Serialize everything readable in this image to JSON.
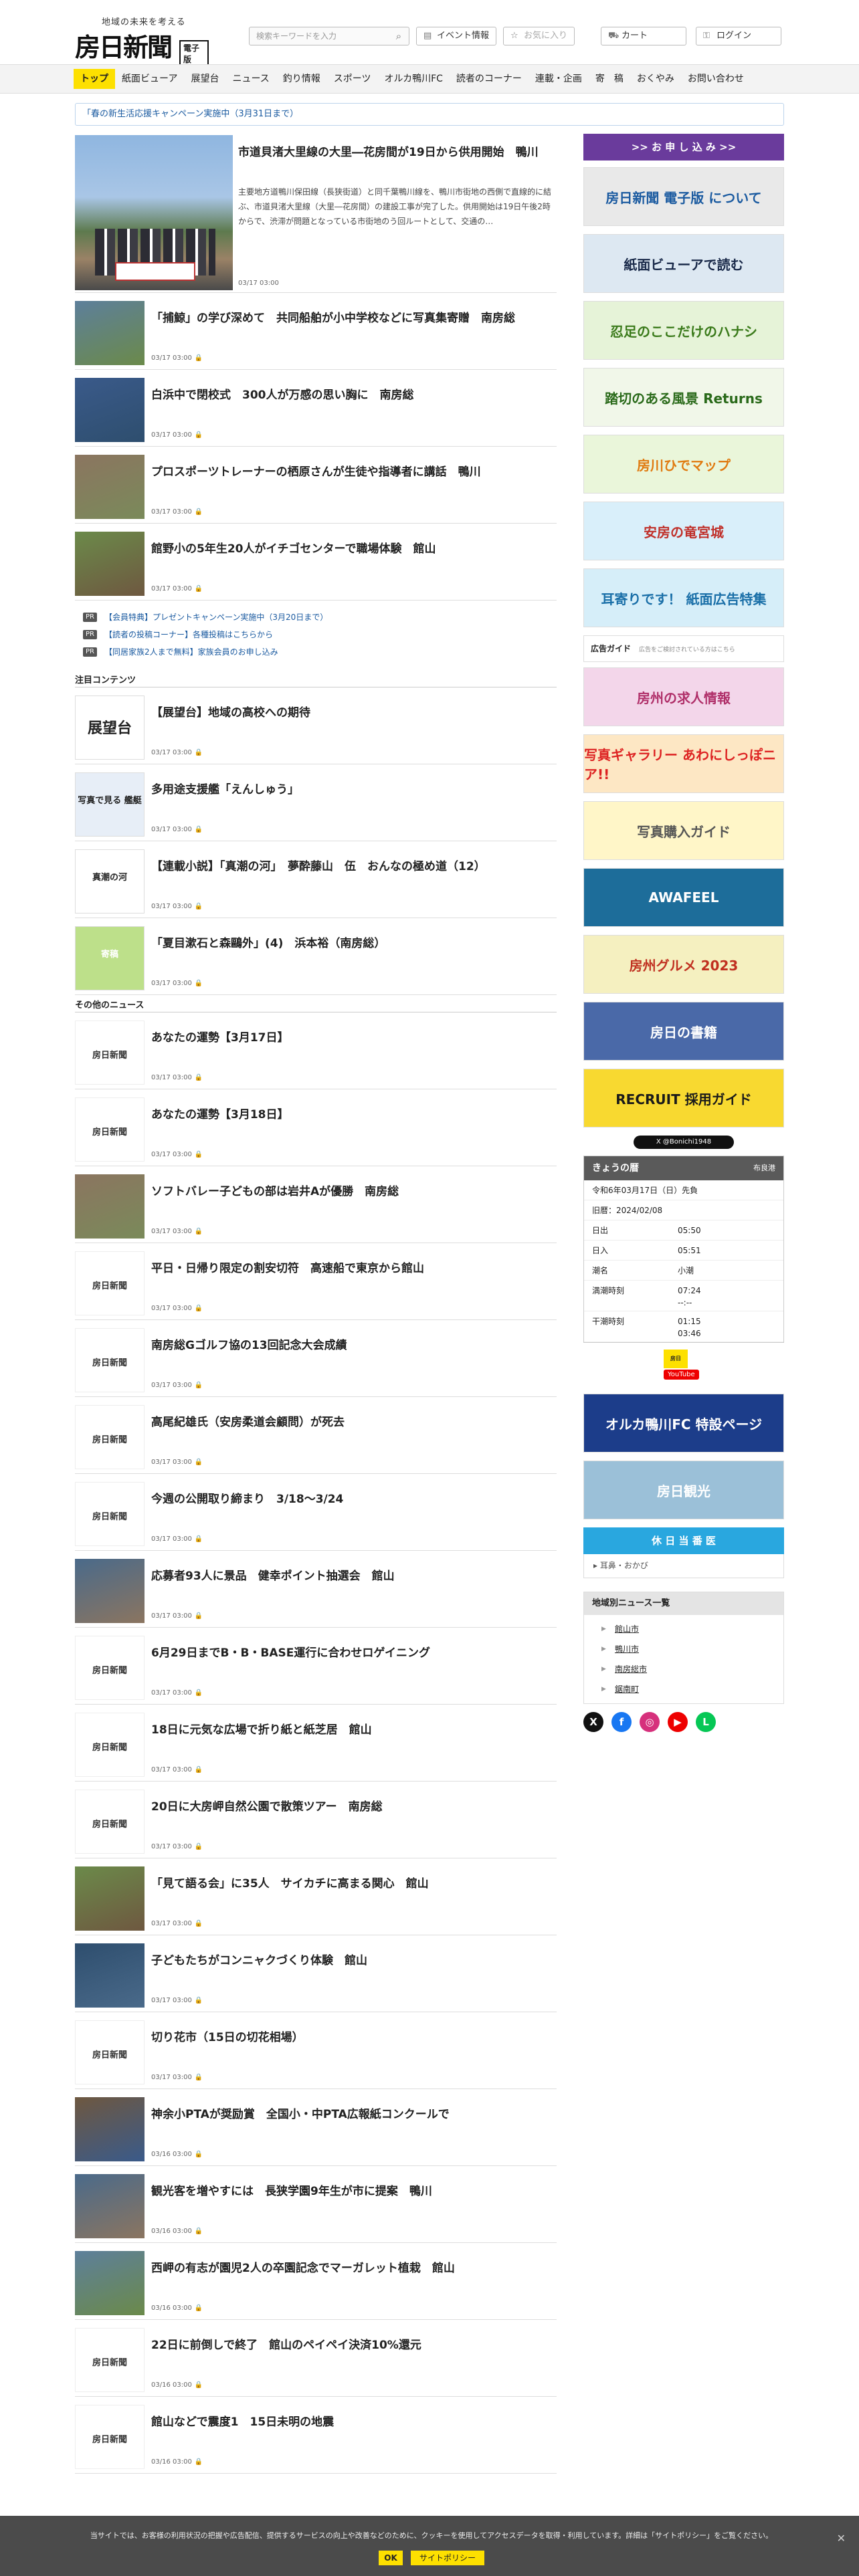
{
  "header": {
    "tagline": "地域の未来を考える",
    "logo_name": "房日新聞",
    "logo_badge": "電子版",
    "search_placeholder": "検索キーワードを入力",
    "buttons": {
      "event": "イベント情報",
      "favorite": "お気に入り",
      "cart": "カート",
      "login": "ログイン"
    }
  },
  "nav": [
    "トップ",
    "紙面ビューア",
    "展望台",
    "ニュース",
    "釣り情報",
    "スポーツ",
    "オルカ鴨川FC",
    "読者のコーナー",
    "連載・企画",
    "寄　稿",
    "おくやみ",
    "お問い合わせ"
  ],
  "notice": "「春の新生活応援キャンペーン実施中（3月31日まで）",
  "lead": {
    "title": "市道貝渚大里線の大里―花房間が19日から供用開始　鴨川",
    "body": "主要地方道鴨川保田線（長狭街道）と同千葉鴨川線を、鴨川市街地の西側で直線的に結ぶ、市道貝渚大里線（大里―花房間）の建設工事が完了した。供用開始は19日午後2時からで、渋滞が問題となっている市街地のう回ルートとして、交通の…",
    "date": "03/17 03:00"
  },
  "top_articles": [
    {
      "title": "「捕鯨」の学び深めて　共同船舶が小中学校などに写真集寄贈　南房総",
      "date": "03/17 03:00"
    },
    {
      "title": "白浜中で閉校式　300人が万感の思い胸に　南房総",
      "date": "03/17 03:00"
    },
    {
      "title": "プロスポーツトレーナーの栖原さんが生徒や指導者に講話　鴨川",
      "date": "03/17 03:00"
    },
    {
      "title": "館野小の5年生20人がイチゴセンターで職場体験　館山",
      "date": "03/17 03:00"
    }
  ],
  "pr": [
    {
      "tag": "PR",
      "text": "【会員特典】プレゼントキャンペーン実施中（3月20日まで）"
    },
    {
      "tag": "PR",
      "text": "【読者の投稿コーナー】各種投稿はこちらから"
    },
    {
      "tag": "PR",
      "text": "【同居家族2人まで無料】家族会員のお申し込み"
    }
  ],
  "featured_heading": "注目コンテンツ",
  "featured": [
    {
      "title": "【展望台】地域の高校への期待",
      "date": "03/17 03:00",
      "thumb_text": "展望台"
    },
    {
      "title": "多用途支援艦「えんしゅう」",
      "date": "03/17 03:00",
      "thumb_text": "写真で見る 艦艇"
    },
    {
      "title": "【連載小説】「真潮の河」　夢酔藤山　伍　おんなの極め道（12）",
      "date": "03/17 03:00",
      "thumb_text": "真潮の河"
    },
    {
      "title": "「夏目漱石と森鷗外」(4)　浜本裕（南房総）",
      "date": "03/17 03:00",
      "thumb_text": "寄稿"
    }
  ],
  "other_heading": "その他のニュース",
  "other_news": [
    {
      "title": "あなたの運勢【3月17日】",
      "date": "03/17 03:00"
    },
    {
      "title": "あなたの運勢【3月18日】",
      "date": "03/17 03:00"
    },
    {
      "title": "ソフトバレー子どもの部は岩井Aが優勝　南房総",
      "date": "03/17 03:00"
    },
    {
      "title": "平日・日帰り限定の割安切符　高速船で東京から館山",
      "date": "03/17 03:00"
    },
    {
      "title": "南房総Gゴルフ協の13回記念大会成績",
      "date": "03/17 03:00"
    },
    {
      "title": "高尾紀雄氏（安房柔道会顧問）が死去",
      "date": "03/17 03:00"
    },
    {
      "title": "今週の公開取り締まり　3/18～3/24",
      "date": "03/17 03:00"
    },
    {
      "title": "応募者93人に景品　健幸ポイント抽選会　館山",
      "date": "03/17 03:00"
    },
    {
      "title": "6月29日までB・B・BASE運行に合わせロゲイニング",
      "date": "03/17 03:00"
    },
    {
      "title": "18日に元気な広場で折り紙と紙芝居　館山",
      "date": "03/17 03:00"
    },
    {
      "title": "20日に大房岬自然公園で散策ツアー　南房総",
      "date": "03/17 03:00"
    },
    {
      "title": "「見て語る会」に35人　サイカチに高まる関心　館山",
      "date": "03/17 03:00"
    },
    {
      "title": "子どもたちがコンニャクづくり体験　館山",
      "date": "03/17 03:00"
    },
    {
      "title": "切り花市（15日の切花相場）",
      "date": "03/17 03:00"
    },
    {
      "title": "神余小PTAが奨励賞　全国小・中PTA広報紙コンクールで",
      "date": "03/16 03:00"
    },
    {
      "title": "観光客を増やすには　長狭学園9年生が市に提案　鴨川",
      "date": "03/16 03:00"
    },
    {
      "title": "西岬の有志が園児2人の卒園記念でマーガレット植栽　館山",
      "date": "03/16 03:00"
    },
    {
      "title": "22日に前倒しで終了　館山のペイペイ決済10%還元",
      "date": "03/16 03:00"
    },
    {
      "title": "館山などで震度1　15日未明の地震",
      "date": "03/16 03:00"
    }
  ],
  "sidebar": {
    "apply": ">> お 申 し 込 み >>",
    "banners": [
      {
        "text": "房日新聞 電子版 について",
        "bg": "#e9e9e9",
        "color": "#1a5aa0"
      },
      {
        "text": "紙面ビューアで読む",
        "bg": "#dde8f2",
        "color": "#1a2a4a"
      },
      {
        "text": "忍足のここだけのハナシ",
        "bg": "#e6f3d8",
        "color": "#3a7a1a"
      },
      {
        "text": "踏切のある風景 Returns",
        "bg": "#f1f7e9",
        "color": "#2a6a1a"
      },
      {
        "text": "房川ひでマップ",
        "bg": "#eaf6da",
        "color": "#e07a10"
      },
      {
        "text": "安房の竜宮城",
        "bg": "#d9effa",
        "color": "#c0302a"
      },
      {
        "text": "耳寄りです！ 紙面広告特集",
        "bg": "#d6eef9",
        "color": "#1a6fa8"
      }
    ],
    "ad_guide": "広告ガイド",
    "ad_guide_note": "広告をご検討されている方はこちら",
    "banners2": [
      {
        "text": "房州の求人情報",
        "bg": "#f3d6ea",
        "color": "#b0306a"
      },
      {
        "text": "写真ギャラリー あわにしっぽニア!!",
        "bg": "#fde7c4",
        "color": "#d22"
      },
      {
        "text": "写真購入ガイド",
        "bg": "#fff6c8",
        "color": "#555"
      },
      {
        "text": "AWAFEEL",
        "bg": "#1d6d9a",
        "color": "#ffffff"
      },
      {
        "text": "房州グルメ 2023",
        "bg": "#f5f0c0",
        "color": "#c03020"
      },
      {
        "text": "房日の書籍",
        "bg": "#4a69a8",
        "color": "#ffffff"
      },
      {
        "text": "RECRUIT 採用ガイド",
        "bg": "#f8d930",
        "color": "#1a1a1a"
      }
    ],
    "twitter": "X @Bonichi1948",
    "calendar": {
      "title": "きょうの暦",
      "note": "布良港",
      "rows": [
        {
          "label": "令和6年03月17日（日）先負",
          "value": ""
        },
        {
          "label": "旧暦：2024/02/08",
          "value": ""
        },
        {
          "label": "日出",
          "value": "05:50"
        },
        {
          "label": "日入",
          "value": "05:51"
        },
        {
          "label": "潮名",
          "value": "小潮"
        },
        {
          "label": "満潮時刻",
          "value": "07:24\n--:--"
        },
        {
          "label": "干潮時刻",
          "value": "01:15\n03:46"
        }
      ]
    },
    "youtube": "YouTube",
    "orca_banner": "オルカ鴨川FC 特設ページ",
    "kanko_banner": "房日観光",
    "holiday": "休 日 当 番 医",
    "holiday_sub": "▸ 耳鼻・おかび",
    "regional_title": "地域別ニュース一覧",
    "regions": [
      "館山市",
      "鴨川市",
      "南房総市",
      "鋸南町"
    ]
  },
  "cookie": {
    "text": "当サイトでは、お客様の利用状況の把握や広告配信、提供するサービスの向上や改善などのために、クッキーを使用してアクセスデータを取得・利用しています。詳細は「サイトポリシー」をご覧ください。",
    "ok": "OK",
    "policy": "サイトポリシー"
  }
}
